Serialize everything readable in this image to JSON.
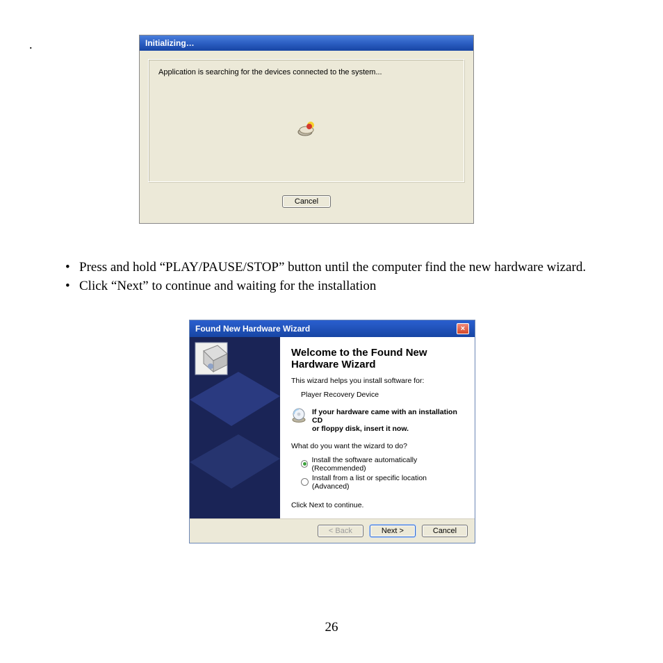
{
  "leading_dot": ".",
  "dialog1": {
    "title": "Initializing…",
    "message": "Application is searching for the devices connected to the system...",
    "cancel_label": "Cancel"
  },
  "instructions": {
    "item1": "Press and hold “PLAY/PAUSE/STOP” button until the computer find the new hardware wizard.",
    "item2": "Click “Next” to continue and waiting for the installation"
  },
  "dialog2": {
    "title": "Found New Hardware Wizard",
    "heading_line1": "Welcome to the Found New",
    "heading_line2": "Hardware Wizard",
    "intro": "This wizard helps you install software for:",
    "device_name": "Player Recovery Device",
    "cd_hint_line1": "If your hardware came with an installation CD",
    "cd_hint_line2": "or floppy disk, insert it now.",
    "question": "What do you want the wizard to do?",
    "option1": "Install the software automatically (Recommended)",
    "option2": "Install from a list or specific location (Advanced)",
    "continue_hint": "Click Next to continue.",
    "back_label": "< Back",
    "next_label": "Next >",
    "cancel_label": "Cancel",
    "close_glyph": "×"
  },
  "page_number": "26"
}
